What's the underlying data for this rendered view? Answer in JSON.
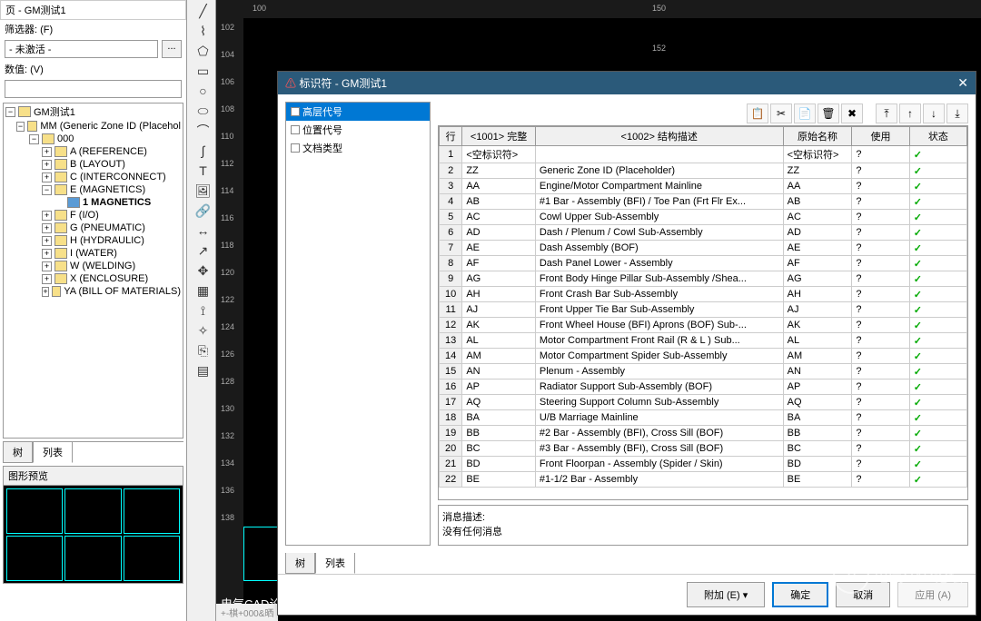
{
  "left_panel": {
    "title": "页 - GM测试1",
    "filter_label": "筛选器: (F)",
    "filter_value": "- 未激活 -",
    "filter_btn": "...",
    "value_label": "数值: (V)",
    "value_input": "",
    "tree": [
      {
        "level": 0,
        "toggle": "−",
        "icon": "folder",
        "label": "GM测试1"
      },
      {
        "level": 1,
        "toggle": "−",
        "icon": "folder",
        "label": "MM (Generic Zone ID (Placehol"
      },
      {
        "level": 2,
        "toggle": "−",
        "icon": "folder",
        "label": "000"
      },
      {
        "level": 3,
        "toggle": "+",
        "icon": "folder",
        "label": "A (REFERENCE)"
      },
      {
        "level": 3,
        "toggle": "+",
        "icon": "folder",
        "label": "B (LAYOUT)"
      },
      {
        "level": 3,
        "toggle": "+",
        "icon": "folder",
        "label": "C (INTERCONNECT)"
      },
      {
        "level": 3,
        "toggle": "−",
        "icon": "folder",
        "label": "E (MAGNETICS)"
      },
      {
        "level": 4,
        "toggle": "",
        "icon": "blue",
        "label": "1 MAGNETICS",
        "bold": true
      },
      {
        "level": 3,
        "toggle": "+",
        "icon": "folder",
        "label": "F (I/O)"
      },
      {
        "level": 3,
        "toggle": "+",
        "icon": "folder",
        "label": "G (PNEUMATIC)"
      },
      {
        "level": 3,
        "toggle": "+",
        "icon": "folder",
        "label": "H (HYDRAULIC)"
      },
      {
        "level": 3,
        "toggle": "+",
        "icon": "folder",
        "label": "I (WATER)"
      },
      {
        "level": 3,
        "toggle": "+",
        "icon": "folder",
        "label": "W (WELDING)"
      },
      {
        "level": 3,
        "toggle": "+",
        "icon": "folder",
        "label": "X (ENCLOSURE)"
      },
      {
        "level": 3,
        "toggle": "+",
        "icon": "folder",
        "label": "YA (BILL OF MATERIALS)"
      }
    ],
    "tabs": {
      "tree": "树",
      "list": "列表"
    },
    "preview_title": "图形预览"
  },
  "canvas": {
    "h_marks": [
      "100",
      "150"
    ],
    "v_marks": [
      "102",
      "104",
      "106",
      "108",
      "110",
      "112",
      "114",
      "116",
      "118",
      "120",
      "122",
      "124",
      "126",
      "128",
      "130",
      "132",
      "134",
      "136",
      "138"
    ],
    "h_mark2": "152",
    "status": "+-棋+000&晒"
  },
  "dialog": {
    "title_icon": "⚠",
    "title": "标识符 - GM测试1",
    "left_items": [
      {
        "label": "高层代号",
        "selected": true
      },
      {
        "label": "位置代号",
        "selected": false
      },
      {
        "label": "文档类型",
        "selected": false
      }
    ],
    "toolbar_icons": [
      "📋",
      "✂",
      "📄",
      "🗑",
      "✖",
      " ",
      "⤒",
      "↑",
      "↓",
      "⤓"
    ],
    "cols": {
      "row": "行",
      "c1": "<1001> 完整",
      "c2": "<1002> 结构描述",
      "c3": "原始名称",
      "c4": "使用",
      "c5": "状态"
    },
    "rows": [
      {
        "n": "1",
        "c1": "<空标识符>",
        "c2": "",
        "c3": "<空标识符>",
        "c4": "?",
        "ok": true
      },
      {
        "n": "2",
        "c1": "ZZ",
        "c2": "Generic Zone ID (Placeholder)",
        "c3": "ZZ",
        "c4": "?",
        "ok": true
      },
      {
        "n": "3",
        "c1": "AA",
        "c2": "Engine/Motor Compartment Mainline",
        "c3": "AA",
        "c4": "?",
        "ok": true
      },
      {
        "n": "4",
        "c1": "AB",
        "c2": "#1 Bar - Assembly (BFI) / Toe Pan (Frt Flr Ex...",
        "c3": "AB",
        "c4": "?",
        "ok": true
      },
      {
        "n": "5",
        "c1": "AC",
        "c2": "Cowl Upper Sub-Assembly",
        "c3": "AC",
        "c4": "?",
        "ok": true
      },
      {
        "n": "6",
        "c1": "AD",
        "c2": "Dash / Plenum / Cowl  Sub-Assembly",
        "c3": "AD",
        "c4": "?",
        "ok": true
      },
      {
        "n": "7",
        "c1": "AE",
        "c2": "Dash Assembly (BOF)",
        "c3": "AE",
        "c4": "?",
        "ok": true
      },
      {
        "n": "8",
        "c1": "AF",
        "c2": "Dash Panel Lower - Assembly",
        "c3": "AF",
        "c4": "?",
        "ok": true
      },
      {
        "n": "9",
        "c1": "AG",
        "c2": "Front Body Hinge Pillar Sub-Assembly /Shea...",
        "c3": "AG",
        "c4": "?",
        "ok": true
      },
      {
        "n": "10",
        "c1": "AH",
        "c2": "Front Crash Bar Sub-Assembly",
        "c3": "AH",
        "c4": "?",
        "ok": true
      },
      {
        "n": "11",
        "c1": "AJ",
        "c2": "Front Upper Tie Bar Sub-Assembly",
        "c3": "AJ",
        "c4": "?",
        "ok": true
      },
      {
        "n": "12",
        "c1": "AK",
        "c2": "Front Wheel House (BFI) Aprons (BOF) Sub-...",
        "c3": "AK",
        "c4": "?",
        "ok": true
      },
      {
        "n": "13",
        "c1": "AL",
        "c2": "Motor Compartment Front Rail (R & L )  Sub...",
        "c3": "AL",
        "c4": "?",
        "ok": true
      },
      {
        "n": "14",
        "c1": "AM",
        "c2": "Motor Compartment Spider  Sub-Assembly",
        "c3": "AM",
        "c4": "?",
        "ok": true
      },
      {
        "n": "15",
        "c1": "AN",
        "c2": "Plenum - Assembly",
        "c3": "AN",
        "c4": "?",
        "ok": true
      },
      {
        "n": "16",
        "c1": "AP",
        "c2": "Radiator Support Sub-Assembly (BOF)",
        "c3": "AP",
        "c4": "?",
        "ok": true
      },
      {
        "n": "17",
        "c1": "AQ",
        "c2": "Steering Support Column  Sub-Assembly",
        "c3": "AQ",
        "c4": "?",
        "ok": true
      },
      {
        "n": "18",
        "c1": "BA",
        "c2": "U/B Marriage Mainline",
        "c3": "BA",
        "c4": "?",
        "ok": true
      },
      {
        "n": "19",
        "c1": "BB",
        "c2": "#2 Bar - Assembly (BFI), Cross Sill (BOF)",
        "c3": "BB",
        "c4": "?",
        "ok": true
      },
      {
        "n": "20",
        "c1": "BC",
        "c2": "#3 Bar - Assembly (BFI), Cross Sill (BOF)",
        "c3": "BC",
        "c4": "?",
        "ok": true
      },
      {
        "n": "21",
        "c1": "BD",
        "c2": "Front Floorpan - Assembly (Spider / Skin)",
        "c3": "BD",
        "c4": "?",
        "ok": true
      },
      {
        "n": "22",
        "c1": "BE",
        "c2": "#1-1/2 Bar - Assembly",
        "c3": "BE",
        "c4": "?",
        "ok": true
      }
    ],
    "msg_label": "消息描述:",
    "msg_text": "没有任何消息",
    "tabs": {
      "tree": "树",
      "list": "列表"
    },
    "footer": {
      "extra": "附加 (E)",
      "ok": "确定",
      "cancel": "取消",
      "apply": "应用 (A)"
    }
  },
  "watermark": "电气CAD论坛",
  "bottom_label": "电气CAD论坛"
}
